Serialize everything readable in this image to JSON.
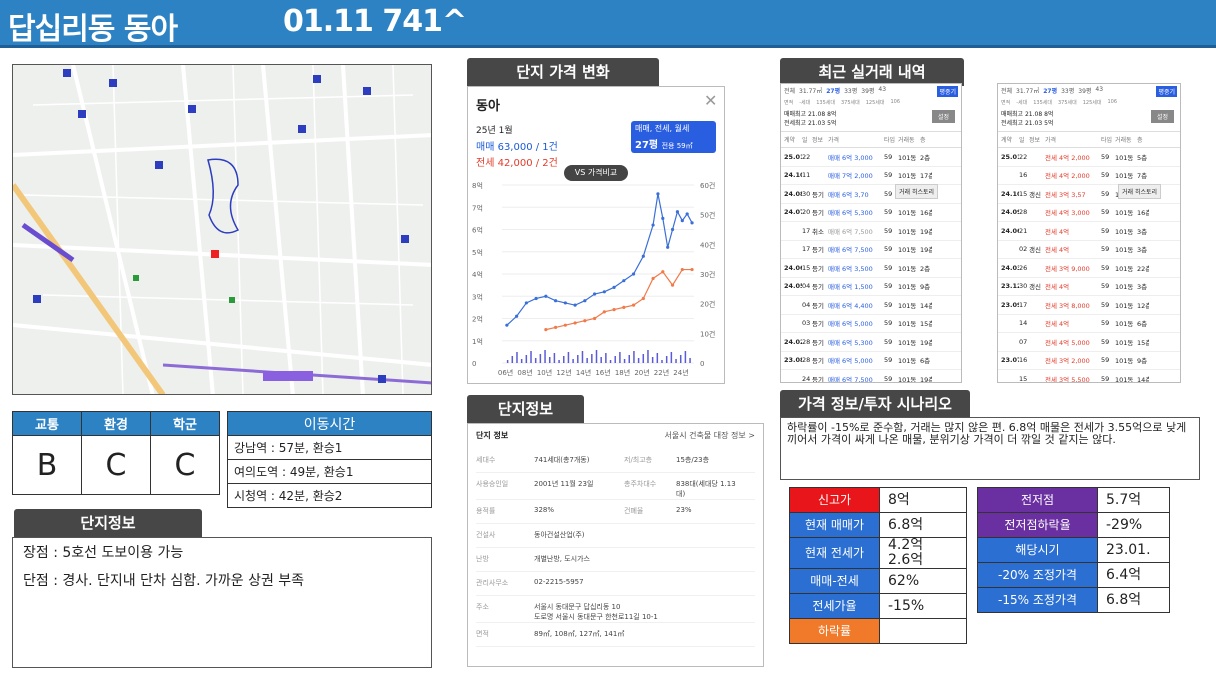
{
  "header": {
    "title": "답십리동 동아",
    "code": "01.11 741^"
  },
  "ratings": {
    "headers": [
      "교통",
      "환경",
      "학군"
    ],
    "values": [
      "B",
      "C",
      "C"
    ]
  },
  "commute": {
    "title": "이동시간",
    "rows": [
      "강남역 : 57분, 환승1",
      "여의도역 : 49분, 환승1",
      "시청역 : 42분, 환승2"
    ]
  },
  "summary": {
    "title": "단지정보",
    "pros": "장점 : 5호선 도보이용 가능",
    "cons": "단점 : 경사. 단지내 단차 심함. 가까운 상권 부족"
  },
  "price_panel": {
    "tab": "단지 가격 변화",
    "name": "동아",
    "date": "25년 1월",
    "sale": "매매 63,000 / 1건",
    "jeonse": "전세 42,000 / 2건",
    "filter": "매매, 전세, 월세",
    "size": "27평",
    "size_note": "전용 59㎡",
    "vs": "VS 가격비교",
    "colors": {
      "sale": "#3a6fd8",
      "jeonse": "#f07a4a",
      "bar": "#5b5bd6"
    }
  },
  "chart_data": {
    "type": "line",
    "y_left_ticks": [
      "8억",
      "7억",
      "6억",
      "5억",
      "4억",
      "3억",
      "2억",
      "1억",
      "0"
    ],
    "y_right_ticks": [
      "60건",
      "50건",
      "40건",
      "30건",
      "20건",
      "10건",
      "0"
    ],
    "x_ticks": [
      "06년",
      "08년",
      "10년",
      "12년",
      "14년",
      "16년",
      "18년",
      "20년",
      "22년",
      "24년"
    ],
    "ylim": [
      0,
      8
    ],
    "series": [
      {
        "name": "매매",
        "x": [
          2006,
          2007,
          2008,
          2009,
          2010,
          2011,
          2012,
          2013,
          2014,
          2015,
          2016,
          2017,
          2018,
          2019,
          2020,
          2021,
          2021.5,
          2022,
          2022.5,
          2023,
          2023.5,
          2024,
          2024.5,
          2025
        ],
        "values": [
          1.7,
          2.1,
          2.7,
          2.9,
          3.0,
          2.8,
          2.7,
          2.6,
          2.8,
          3.1,
          3.2,
          3.4,
          3.7,
          4.0,
          4.8,
          6.2,
          7.6,
          6.5,
          5.2,
          6.0,
          6.8,
          6.4,
          6.7,
          6.3
        ]
      },
      {
        "name": "전세",
        "x": [
          2010,
          2011,
          2012,
          2013,
          2014,
          2015,
          2016,
          2017,
          2018,
          2019,
          2020,
          2021,
          2022,
          2023,
          2024,
          2025
        ],
        "values": [
          1.5,
          1.6,
          1.7,
          1.8,
          1.9,
          2.0,
          2.3,
          2.4,
          2.5,
          2.6,
          2.9,
          3.8,
          4.1,
          3.5,
          4.2,
          4.2
        ]
      }
    ]
  },
  "deals": {
    "tab": "최근 실거래 내역",
    "top_cells": [
      "전체",
      "31.77㎡",
      "27평",
      "33평",
      "39평",
      "43",
      "평중기"
    ],
    "top_cells2": [
      "면적",
      "-세대",
      "135세대",
      "375세대",
      "125세대",
      "106"
    ],
    "max_sale": "매매최고 21.08 8억",
    "max_jeonse": "전세최고 21.03 5억",
    "setting": "설정",
    "cols": [
      "계약",
      "일",
      "정보",
      "가격",
      "타입",
      "거래동",
      "층"
    ],
    "tooltip": "거래 히스토리",
    "left": [
      [
        "25.01",
        "22",
        "",
        "매매 6억 3,000",
        "59",
        "101동",
        "2층"
      ],
      [
        "24.10",
        "11",
        "",
        "매매 7억 2,000",
        "59",
        "101동",
        "17층"
      ],
      [
        "24.08",
        "30",
        "등기",
        "매매 6억 3,70",
        "59",
        "101동",
        "1층"
      ],
      [
        "24.07",
        "20",
        "등기",
        "매매 6억 5,300",
        "59",
        "101동",
        "16층"
      ],
      [
        "",
        "17",
        "취소",
        "매매 6억 7,500",
        "59",
        "101동",
        "19층"
      ],
      [
        "",
        "17",
        "등기",
        "매매 6억 7,500",
        "59",
        "101동",
        "19층"
      ],
      [
        "24.06",
        "15",
        "등기",
        "매매 6억 3,500",
        "59",
        "101동",
        "2층"
      ],
      [
        "24.05",
        "04",
        "등기",
        "매매 6억 1,500",
        "59",
        "101동",
        "9층"
      ],
      [
        "",
        "04",
        "등기",
        "매매 6억 4,400",
        "59",
        "101동",
        "14층"
      ],
      [
        "",
        "03",
        "등기",
        "매매 6억 5,000",
        "59",
        "101동",
        "15층"
      ],
      [
        "24.02",
        "28",
        "등기",
        "매매 6억 5,300",
        "59",
        "101동",
        "19층"
      ],
      [
        "23.08",
        "28",
        "등기",
        "매매 6억 5,000",
        "59",
        "101동",
        "6층"
      ],
      [
        "",
        "24",
        "등기",
        "매매 6억 7,500",
        "59",
        "101동",
        "19층"
      ]
    ],
    "right": [
      [
        "25.01",
        "22",
        "",
        "전세 4억 2,000",
        "59",
        "101동",
        "5층"
      ],
      [
        "",
        "16",
        "",
        "전세 4억 2,000",
        "59",
        "101동",
        "7층"
      ],
      [
        "24.10",
        "15",
        "갱신",
        "전세 3억 3,57",
        "59",
        "101동",
        "4층"
      ],
      [
        "24.09",
        "28",
        "",
        "전세 4억 3,000",
        "59",
        "101동",
        "16층"
      ],
      [
        "24.06",
        "21",
        "",
        "전세 4억",
        "59",
        "101동",
        "3층"
      ],
      [
        "",
        "02",
        "갱신",
        "전세 4억",
        "59",
        "101동",
        "3층"
      ],
      [
        "24.03",
        "26",
        "",
        "전세 3억 9,000",
        "59",
        "101동",
        "22층"
      ],
      [
        "23.12",
        "30",
        "갱신",
        "전세 4억",
        "59",
        "101동",
        "3층"
      ],
      [
        "23.09",
        "17",
        "",
        "전세 3억 8,000",
        "59",
        "101동",
        "12층"
      ],
      [
        "",
        "14",
        "",
        "전세 4억",
        "59",
        "101동",
        "6층"
      ],
      [
        "",
        "07",
        "",
        "전세 4억 5,000",
        "59",
        "101동",
        "15층"
      ],
      [
        "23.07",
        "16",
        "",
        "전세 3억 2,000",
        "59",
        "101동",
        "9층"
      ],
      [
        "",
        "15",
        "",
        "전세 3억 5,500",
        "59",
        "101동",
        "14층"
      ]
    ]
  },
  "complex": {
    "tab": "단지정보",
    "title": "단지 정보",
    "link": "서울시 건축물 대장 정보 >",
    "rows": [
      {
        "k1": "세대수",
        "v1": "741세대(총7개동)",
        "k2": "저/최고층",
        "v2": "15층/23층"
      },
      {
        "k1": "사용승인일",
        "v1": "2001년 11월 23일",
        "k2": "총주차대수",
        "v2": "838대(세대당 1.13대)"
      },
      {
        "k1": "용적률",
        "v1": "328%",
        "k2": "건폐율",
        "v2": "23%"
      },
      {
        "k1": "건설사",
        "v1": "동아건설산업(주)"
      },
      {
        "k1": "난방",
        "v1": "개별난방, 도시가스"
      },
      {
        "k1": "관리사무소",
        "v1": "02-2215-5957"
      },
      {
        "k1": "주소",
        "v1": "서울시 동대문구 답십리동 10",
        "v1b": "도로명  서울시 동대문구 한천로11길 10-1"
      },
      {
        "k1": "면적",
        "v1": "89㎡, 108㎡, 127㎡, 141㎡"
      }
    ]
  },
  "scenario": {
    "tab": "가격 정보/투자 시나리오",
    "text": "하락률이 -15%로 준수함, 거래는 많지 않은 편. 6.8억 매물은 전세가 3.55억으로 낮게 끼어서 가격이 싸게 나온 매물, 분위기상 가격이 더 깎일 것 같지는 않다."
  },
  "price_left": [
    {
      "label": "신고가",
      "value": "8억",
      "color": "#e8161a"
    },
    {
      "label": "현재 매매가",
      "value": "6.8억",
      "color": "#2a6fd1"
    },
    {
      "label": "현재 전세가",
      "value": "4.2억",
      "value2": "2.6억",
      "color": "#2a6fd1"
    },
    {
      "label": "매매-전세",
      "value": "62%",
      "color": "#2a6fd1"
    },
    {
      "label": "전세가율",
      "value": "-15%",
      "color": "#2a6fd1"
    },
    {
      "label": "하락률",
      "value": "",
      "color": "#f07a2a"
    }
  ],
  "price_right": [
    {
      "label": "전저점",
      "value": "5.7억",
      "color": "#6a2fa0"
    },
    {
      "label": "전저점하락율",
      "value": "-29%",
      "color": "#6a2fa0"
    },
    {
      "label": "해당시기",
      "value": "23.01.",
      "color": "#2a6fd1"
    },
    {
      "label": "-20% 조정가격",
      "value": "6.4억",
      "color": "#2a6fd1"
    },
    {
      "label": "-15% 조정가격",
      "value": "6.8억",
      "color": "#2a6fd1"
    }
  ]
}
